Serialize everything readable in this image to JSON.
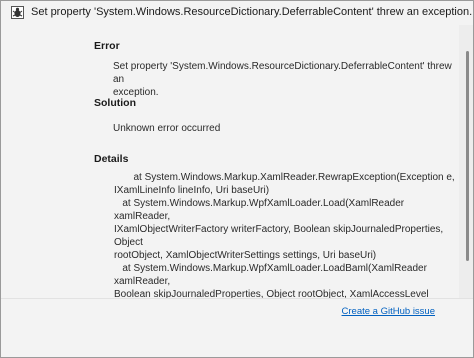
{
  "window": {
    "title": "Set property 'System.Windows.ResourceDictionary.DeferrableContent' threw an exception.",
    "icon": "bug-app-icon"
  },
  "error": {
    "header": "Error",
    "message_line1": "Set property 'System.Windows.ResourceDictionary.DeferrableContent' threw an",
    "message_line2": "exception."
  },
  "solution": {
    "header": "Solution",
    "text": "Unknown error occurred"
  },
  "details": {
    "header": "Details",
    "text": "       at System.Windows.Markup.XamlReader.RewrapException(Exception e,\nIXamlLineInfo lineInfo, Uri baseUri)\n   at System.Windows.Markup.WpfXamlLoader.Load(XamlReader xamlReader,\nIXamlObjectWriterFactory writerFactory, Boolean skipJournaledProperties, Object\nrootObject, XamlObjectWriterSettings settings, Uri baseUri)\n   at System.Windows.Markup.WpfXamlLoader.LoadBaml(XamlReader xamlReader,\nBoolean skipJournaledProperties, Object rootObject, XamlAccessLevel accessLevel, Uri\nbaseUri)\n   at System.Windows.Markup.XamlReader.LoadBaml(Stream stream, ParserContext\n      parserContext, Object parent, Boolean closeStream)"
  },
  "footer": {
    "github_link": "Create a GitHub issue"
  },
  "colors": {
    "link": "#0060c0",
    "background": "#f3f3f3"
  }
}
